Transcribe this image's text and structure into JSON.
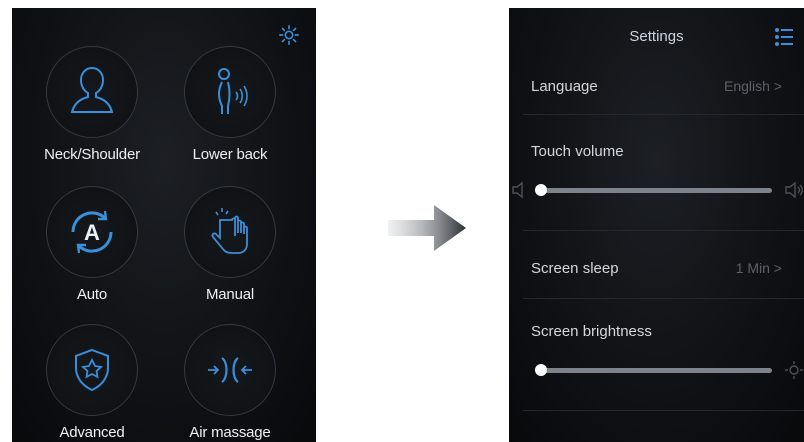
{
  "home": {
    "modes": [
      {
        "label": "Neck/Shoulder",
        "icon": "head-shoulders-icon"
      },
      {
        "label": "Lower back",
        "icon": "lower-back-icon"
      },
      {
        "label": "Auto",
        "icon": "auto-icon"
      },
      {
        "label": "Manual",
        "icon": "manual-hand-icon"
      },
      {
        "label": "Advanced",
        "icon": "shield-star-icon"
      },
      {
        "label": "Air massage",
        "icon": "air-massage-icon"
      }
    ]
  },
  "settings": {
    "title": "Settings",
    "language": {
      "label": "Language",
      "value": "English >"
    },
    "touch_volume": {
      "label": "Touch volume",
      "level": 0.0
    },
    "screen_sleep": {
      "label": "Screen sleep",
      "value": "1 Min >"
    },
    "screen_brightness": {
      "label": "Screen brightness",
      "level": 0.0
    }
  },
  "colors": {
    "accent": "#3a8fd8",
    "screen_bg": "#101215",
    "text": "#e8ecf0",
    "muted": "#5b616a"
  }
}
